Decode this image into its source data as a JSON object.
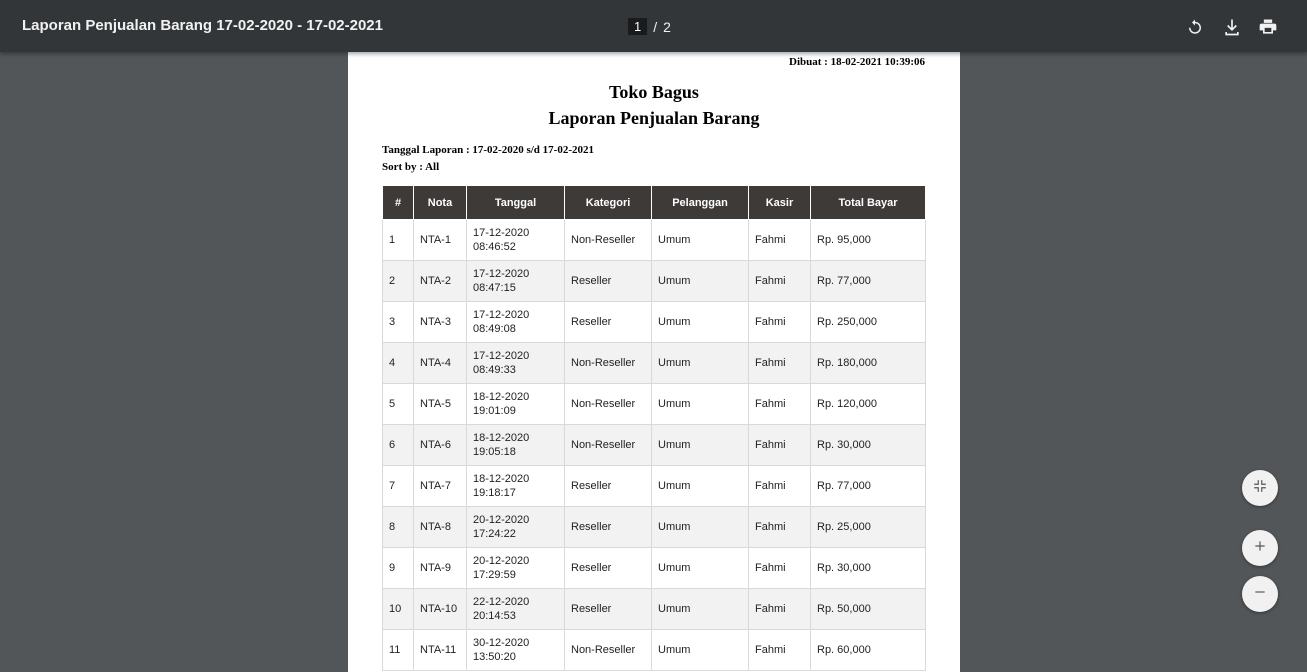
{
  "toolbar": {
    "title": "Laporan Penjualan Barang 17-02-2020 - 17-02-2021",
    "current_page": "1",
    "separator": "/",
    "total_pages": "2",
    "icons": [
      "rotate-icon",
      "download-icon",
      "print-icon"
    ]
  },
  "document": {
    "dibuat": "Dibuat : 18-02-2021 10:39:06",
    "store_name": "Toko Bagus",
    "report_title": "Laporan Penjualan Barang",
    "tanggal_laporan": "Tanggal Laporan : 17-02-2020 s/d 17-02-2021",
    "sort_by": "Sort by : All"
  },
  "table": {
    "headers": [
      "#",
      "Nota",
      "Tanggal",
      "Kategori",
      "Pelanggan",
      "Kasir",
      "Total Bayar"
    ],
    "rows": [
      [
        "1",
        "NTA-1",
        "17-12-2020",
        "08:46:52",
        "Non-Reseller",
        "Umum",
        "Fahmi",
        "Rp. 95,000"
      ],
      [
        "2",
        "NTA-2",
        "17-12-2020",
        "08:47:15",
        "Reseller",
        "Umum",
        "Fahmi",
        "Rp. 77,000"
      ],
      [
        "3",
        "NTA-3",
        "17-12-2020",
        "08:49:08",
        "Reseller",
        "Umum",
        "Fahmi",
        "Rp. 250,000"
      ],
      [
        "4",
        "NTA-4",
        "17-12-2020",
        "08:49:33",
        "Non-Reseller",
        "Umum",
        "Fahmi",
        "Rp. 180,000"
      ],
      [
        "5",
        "NTA-5",
        "18-12-2020",
        "19:01:09",
        "Non-Reseller",
        "Umum",
        "Fahmi",
        "Rp. 120,000"
      ],
      [
        "6",
        "NTA-6",
        "18-12-2020",
        "19:05:18",
        "Non-Reseller",
        "Umum",
        "Fahmi",
        "Rp. 30,000"
      ],
      [
        "7",
        "NTA-7",
        "18-12-2020",
        "19:18:17",
        "Reseller",
        "Umum",
        "Fahmi",
        "Rp. 77,000"
      ],
      [
        "8",
        "NTA-8",
        "20-12-2020",
        "17:24:22",
        "Reseller",
        "Umum",
        "Fahmi",
        "Rp. 25,000"
      ],
      [
        "9",
        "NTA-9",
        "20-12-2020",
        "17:29:59",
        "Reseller",
        "Umum",
        "Fahmi",
        "Rp. 30,000"
      ],
      [
        "10",
        "NTA-10",
        "22-12-2020",
        "20:14:53",
        "Reseller",
        "Umum",
        "Fahmi",
        "Rp. 50,000"
      ],
      [
        "11",
        "NTA-11",
        "30-12-2020",
        "13:50:20",
        "Non-Reseller",
        "Umum",
        "Fahmi",
        "Rp. 60,000"
      ]
    ]
  },
  "controls": {
    "fit_icon": "fit-to-page-icon",
    "zoom_in_icon": "zoom-in-icon",
    "zoom_out_icon": "zoom-out-icon"
  }
}
